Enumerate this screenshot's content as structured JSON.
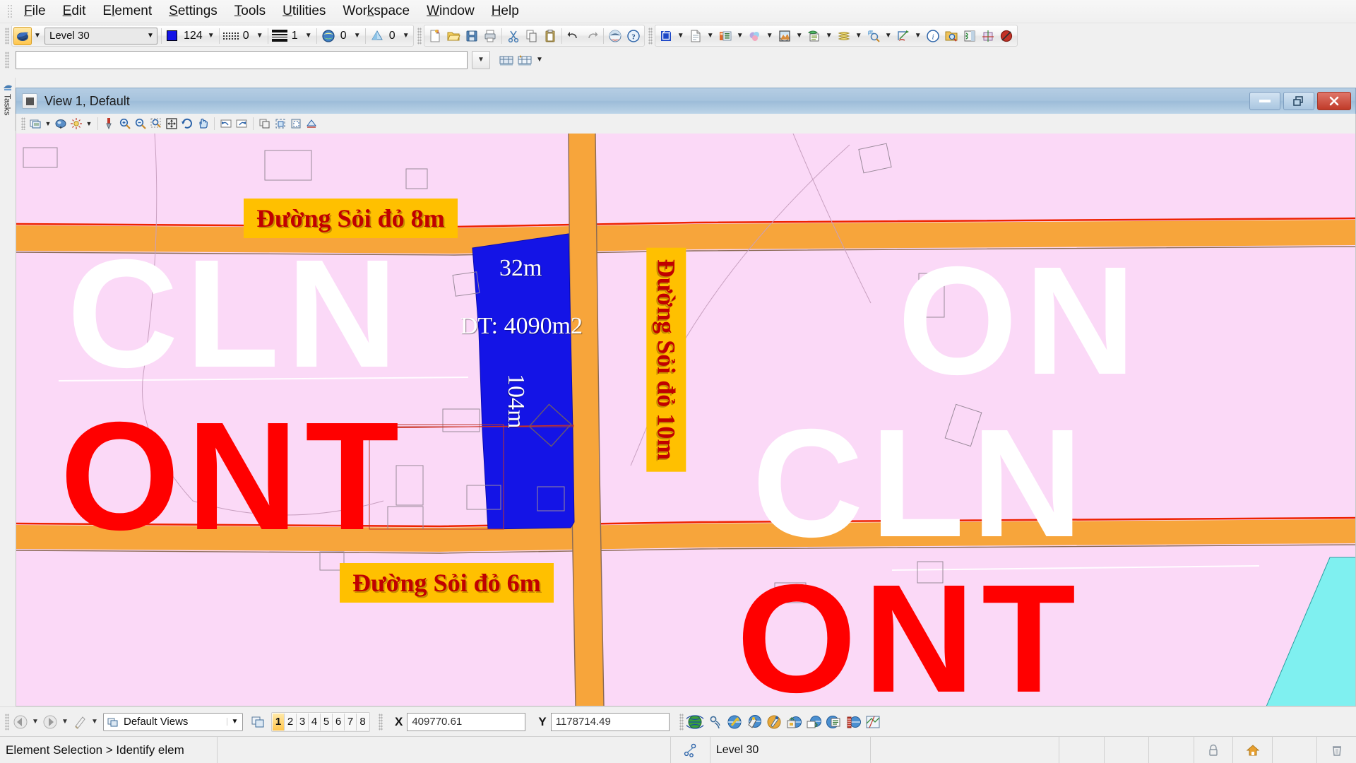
{
  "app": {
    "title": "MicroStation"
  },
  "menubar": {
    "items": [
      {
        "label": "File",
        "accel": "F"
      },
      {
        "label": "Edit",
        "accel": "E"
      },
      {
        "label": "Element",
        "accel": "l"
      },
      {
        "label": "Settings",
        "accel": "S"
      },
      {
        "label": "Tools",
        "accel": "T"
      },
      {
        "label": "Utilities",
        "accel": "U"
      },
      {
        "label": "Workspace",
        "accel": "k"
      },
      {
        "label": "Window",
        "accel": "W"
      },
      {
        "label": "Help",
        "accel": "H"
      }
    ]
  },
  "attributes_toolbar": {
    "active_level_icon": "level-symbology-icon",
    "level_name": "Level 30",
    "color_swatch": "#1414e6",
    "color_value": "124",
    "linestyle_value": "0",
    "lineweight_value": "1",
    "transparency_value": "0",
    "priority_value": "0",
    "icons": [
      "new-file-icon",
      "open-folder-icon",
      "save-icon",
      "print-icon",
      "cut-icon",
      "copy-icon",
      "paste-icon",
      "undo-icon",
      "redo-icon",
      "microstation-icon",
      "help-icon"
    ],
    "primary_icons": [
      "models-icon",
      "references-icon",
      "raster-manager-icon",
      "point-cloud-icon",
      "terrain-model-icon",
      "level-manager-icon",
      "level-display-icon",
      "element-selection-icon",
      "element-information-icon"
    ],
    "right_icons": [
      "info-circle-icon",
      "find-folder-icon",
      "compare-icon",
      "snap-grid-icon",
      "no-entry-icon"
    ]
  },
  "keyin": {
    "value": "",
    "placeholder": "",
    "dropdown_icon": "chevron-down-icon",
    "buttons": [
      "keyin-browser-icon",
      "keyin-history-icon"
    ]
  },
  "tasks_panel": {
    "label": "Tasks",
    "icon": "tasks-icon"
  },
  "view_window": {
    "title": "View 1, Default",
    "window_icon": "view-control-icon",
    "minimize_label": "",
    "restore_label": "",
    "close_label": "✕",
    "toolbar_icons": [
      "view-attributes-icon",
      "chevron-down-icon",
      "view-display-style-icon",
      "view-brightness-icon",
      "chevron-down-icon",
      "update-view-icon",
      "zoom-in-icon",
      "zoom-out-icon",
      "window-area-icon",
      "fit-view-icon",
      "rotate-view-icon",
      "pan-view-icon",
      "view-previous-icon",
      "view-next-icon",
      "copy-view-icon",
      "clip-volume-icon",
      "clip-mask-icon",
      "clip-front-icon"
    ]
  },
  "map": {
    "background_color": "#fbd9f7",
    "road_color": "#f7a53b",
    "parcel_color": "#1414e6",
    "road_labels": [
      {
        "text": "Đường Sỏi đỏ 8m",
        "rotation": 0
      },
      {
        "text": "Đường Sỏi đỏ 10m",
        "rotation": 90
      },
      {
        "text": "Đường Sỏi đỏ 6m",
        "rotation": 0
      }
    ],
    "parcel_labels": [
      {
        "text": "32m",
        "rotation": 0
      },
      {
        "text": "DT: 4090m2",
        "rotation": 0
      },
      {
        "text": "104m",
        "rotation": 90
      }
    ],
    "zone_labels": [
      {
        "text": "CLN",
        "color": "#ffffff"
      },
      {
        "text": "ONT",
        "color": "#ff0000"
      },
      {
        "text": "ON",
        "color": "#ffffff"
      },
      {
        "text": "CLN",
        "color": "#ffffff"
      },
      {
        "text": "ONT",
        "color": "#ff0000"
      }
    ]
  },
  "bottombar": {
    "back_icon": "back-arrow-icon",
    "forward_icon": "forward-arrow-icon",
    "pointer_icon": "view-pointer-icon",
    "view_groups_icon": "view-groups-icon",
    "view_group_name": "Default Views",
    "view_numbers": [
      "1",
      "2",
      "3",
      "4",
      "5",
      "6",
      "7",
      "8"
    ],
    "active_view_number": "1",
    "x_label": "X",
    "x_value": "409770.61",
    "y_label": "Y",
    "y_value": "1178714.49",
    "right_icons": [
      "globe-icon",
      "gps-icon",
      "geo-coordinate-icon",
      "geo-select-icon",
      "geo-marker-icon",
      "geo-export-icon",
      "geo-import-icon",
      "geo-list-icon",
      "measure-icon",
      "geo-map-icon"
    ]
  },
  "statusbar": {
    "message": "Element Selection > Identify elem",
    "level_icon": "element-snap-icon",
    "level": "Level 30",
    "cells": [
      "",
      "",
      "",
      ""
    ],
    "icons": [
      "lock-icon",
      "home-icon",
      "",
      "trash-icon"
    ]
  }
}
